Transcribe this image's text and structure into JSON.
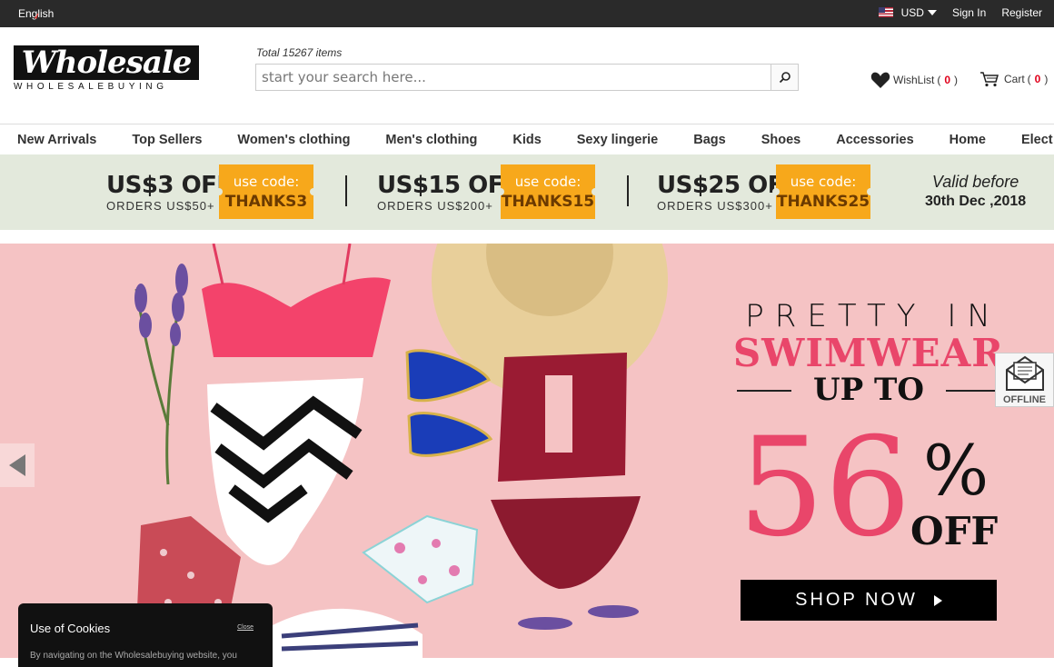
{
  "topbar": {
    "language": "English",
    "currency": "USD",
    "sign_in": "Sign In",
    "register": "Register"
  },
  "header": {
    "logo_main": "Wholesale",
    "logo_sub": "WHOLESALEBUYING",
    "total_items": "Total 15267 items",
    "search_placeholder": "start your search here...",
    "wishlist_label": "WishList",
    "wishlist_count": "0",
    "cart_label": "Cart",
    "cart_count": "0"
  },
  "nav": [
    "New Arrivals",
    "Top Sellers",
    "Women's clothing",
    "Men's clothing",
    "Kids",
    "Sexy lingerie",
    "Bags",
    "Shoes",
    "Accessories",
    "Home",
    "Elect"
  ],
  "promo": {
    "deals": [
      {
        "amount": "US$3 OFF",
        "min": "ORDERS US$50+",
        "use": "use code:",
        "code": "THANKS3"
      },
      {
        "amount": "US$15 OFF",
        "min": "ORDERS US$200+",
        "use": "use code:",
        "code": "THANKS15"
      },
      {
        "amount": "US$25 OFF",
        "min": "ORDERS US$300+",
        "use": "use code:",
        "code": "THANKS25"
      }
    ],
    "valid_line1": "Valid before",
    "valid_line2": "30th Dec ,2018"
  },
  "banner": {
    "line1": "PRETTY IN",
    "line2": "SWIMWEAR",
    "line3": "UP TO",
    "percent": "56",
    "percent_sign": "%",
    "off": "OFF",
    "cta": "SHOP NOW"
  },
  "chat_widget": {
    "label": "OFFLINE"
  },
  "cookie": {
    "title": "Use of Cookies",
    "close": "Close",
    "text": "By navigating on the Wholesalebuying website, you"
  },
  "colors": {
    "topbar_bg": "#2a2a2a",
    "promo_bg": "#e3e9dc",
    "code_badge": "#f7a81b",
    "banner_bg": "#f5c3c4",
    "accent_pink": "#e9466a",
    "count_red": "#e0001b"
  }
}
